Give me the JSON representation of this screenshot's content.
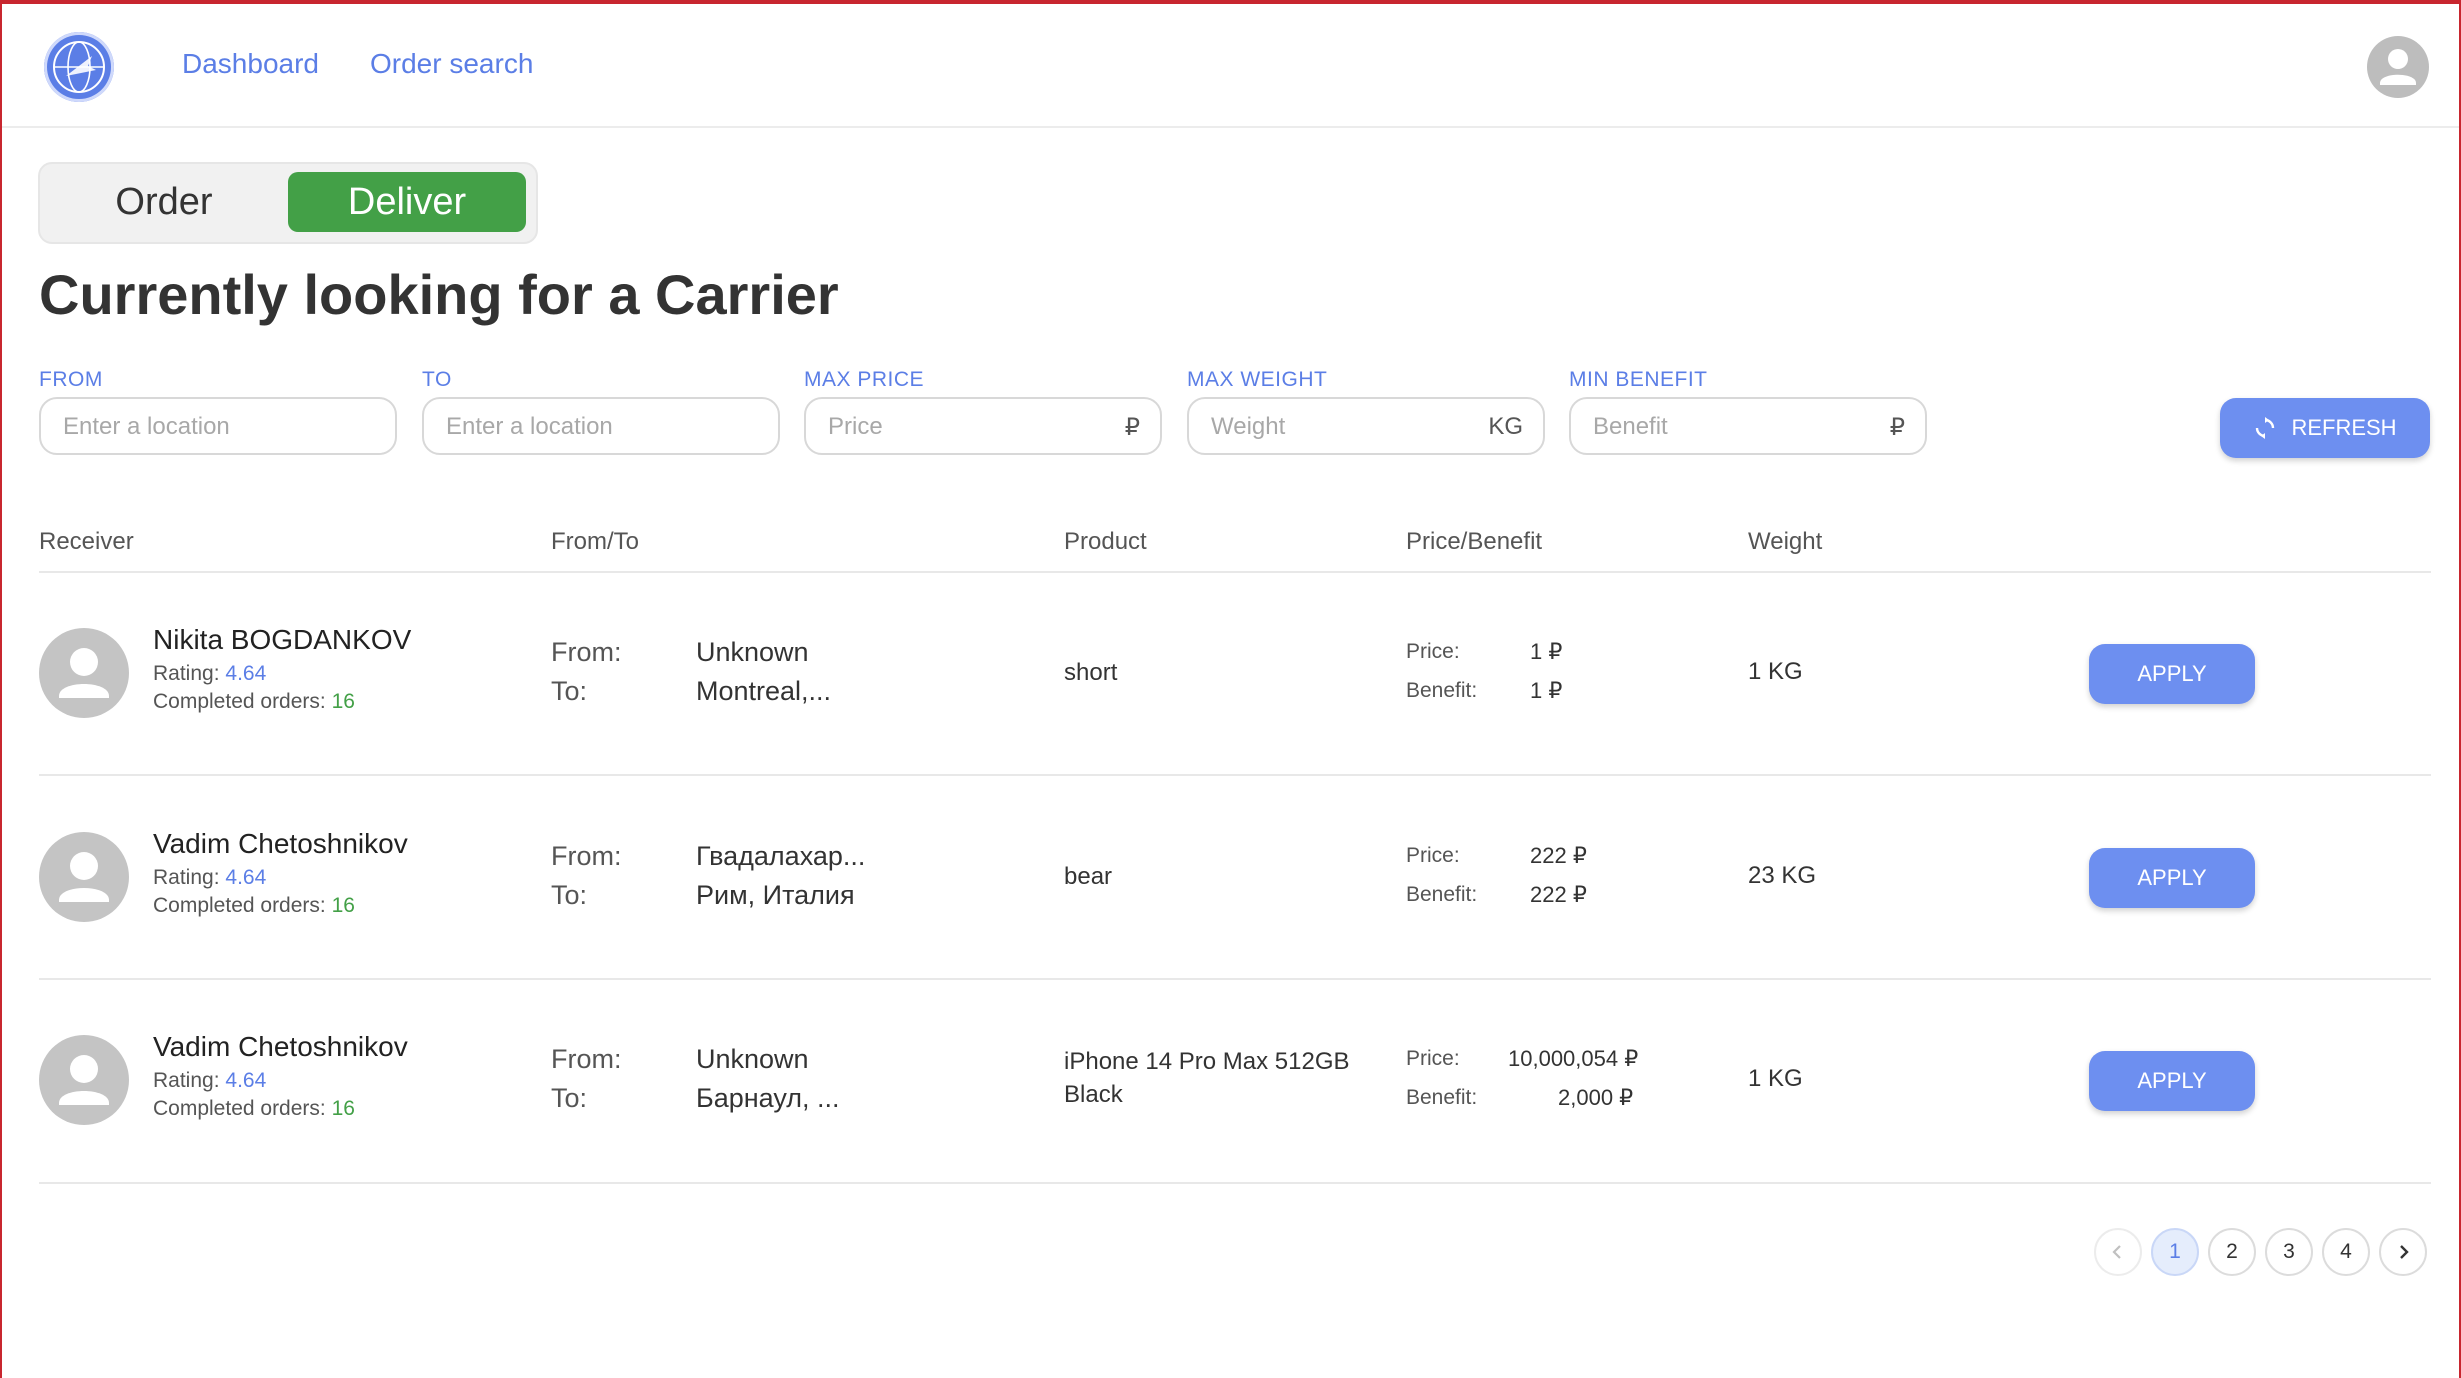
{
  "nav": {
    "dashboard": "Dashboard",
    "order_search": "Order search",
    "logo_icon": "globe-logo-icon",
    "profile_icon": "user-avatar-icon"
  },
  "toggle": {
    "order": "Order",
    "deliver": "Deliver",
    "active": "Deliver"
  },
  "page_title": "Currently looking for a Carrier",
  "filters": {
    "from": {
      "label": "FROM",
      "placeholder": "Enter a location"
    },
    "to": {
      "label": "TO",
      "placeholder": "Enter a location"
    },
    "max_price": {
      "label": "MAX PRICE",
      "placeholder": "Price",
      "suffix": "₽"
    },
    "max_weight": {
      "label": "MAX WEIGHT",
      "placeholder": "Weight",
      "suffix": "KG"
    },
    "min_benefit": {
      "label": "MIN BENEFIT",
      "placeholder": "Benefit",
      "suffix": "₽"
    },
    "refresh": "REFRESH"
  },
  "table": {
    "headers": [
      "Receiver",
      "From/To",
      "Product",
      "Price/Benefit",
      "Weight"
    ],
    "labels": {
      "rating": "Rating:",
      "completed": "Completed orders:",
      "from": "From:",
      "to": "To:",
      "price": "Price:",
      "benefit": "Benefit:",
      "apply": "APPLY"
    },
    "rows": [
      {
        "name": "Nikita BOGDANKOV",
        "rating": "4.64",
        "completed": "16",
        "from": "Unknown",
        "to": "Montreal,...",
        "product": "short",
        "price": "1 ₽",
        "benefit": "1 ₽",
        "weight": "1 KG"
      },
      {
        "name": "Vadim Chetoshnikov",
        "rating": "4.64",
        "completed": "16",
        "from": "Гвадалахар...",
        "to": "Рим, Италия",
        "product": "bear",
        "price": "222 ₽",
        "benefit": "222 ₽",
        "weight": "23 KG"
      },
      {
        "name": "Vadim Chetoshnikov",
        "rating": "4.64",
        "completed": "16",
        "from": "Unknown",
        "to": "Барнаул, ...",
        "product": "iPhone 14 Pro Max 512GB Black",
        "price": "10,000,054 ₽",
        "benefit": "2,000 ₽",
        "weight": "1 KG"
      }
    ]
  },
  "pagination": {
    "prev_icon": "chevron-left-icon",
    "next_icon": "chevron-right-icon",
    "pages": [
      "1",
      "2",
      "3",
      "4"
    ],
    "current": "1"
  },
  "colors": {
    "accent": "#5b7ee6",
    "button": "#6d8ff0",
    "success": "#43a047",
    "frame": "#c8262f"
  }
}
